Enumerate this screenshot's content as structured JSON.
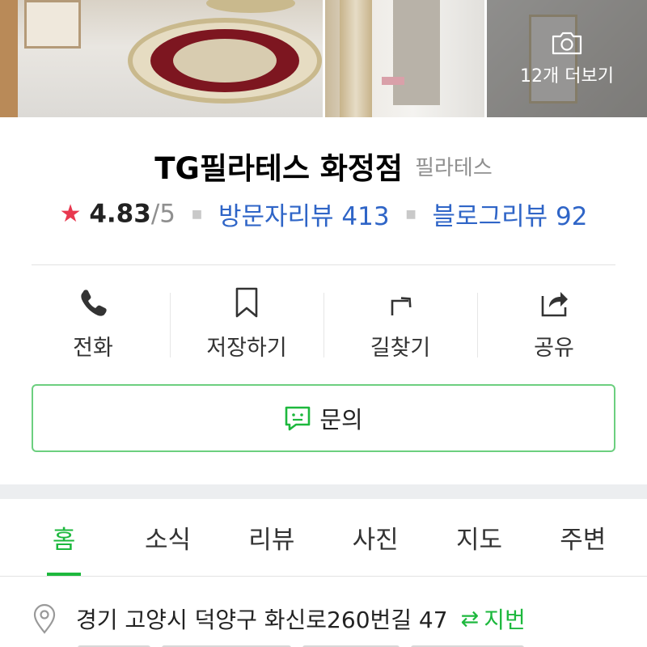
{
  "photos": {
    "more_label": "12개 더보기",
    "camera_icon": "camera-icon"
  },
  "place": {
    "name": "TG필라테스 화정점",
    "category": "필라테스"
  },
  "rating": {
    "score": "4.83",
    "max": "/5",
    "visitor_reviews": "방문자리뷰 413",
    "blog_reviews": "블로그리뷰 92",
    "star_color": "#e8384f",
    "link_color": "#2f65c7"
  },
  "actions": [
    {
      "label": "전화",
      "icon": "phone-icon"
    },
    {
      "label": "저장하기",
      "icon": "bookmark-icon"
    },
    {
      "label": "길찾기",
      "icon": "directions-icon"
    },
    {
      "label": "공유",
      "icon": "share-icon"
    }
  ],
  "inquiry": {
    "label": "문의",
    "icon": "chat-icon",
    "accent": "#1db83d"
  },
  "tabs": [
    {
      "label": "홈",
      "active": true
    },
    {
      "label": "소식",
      "active": false
    },
    {
      "label": "리뷰",
      "active": false
    },
    {
      "label": "사진",
      "active": false
    },
    {
      "label": "지도",
      "active": false
    },
    {
      "label": "주변",
      "active": false
    }
  ],
  "address": {
    "text": "경기 고양시 덕양구 화신로260번길 47",
    "jibun_label": "지번",
    "icon": "location-pin-icon"
  }
}
